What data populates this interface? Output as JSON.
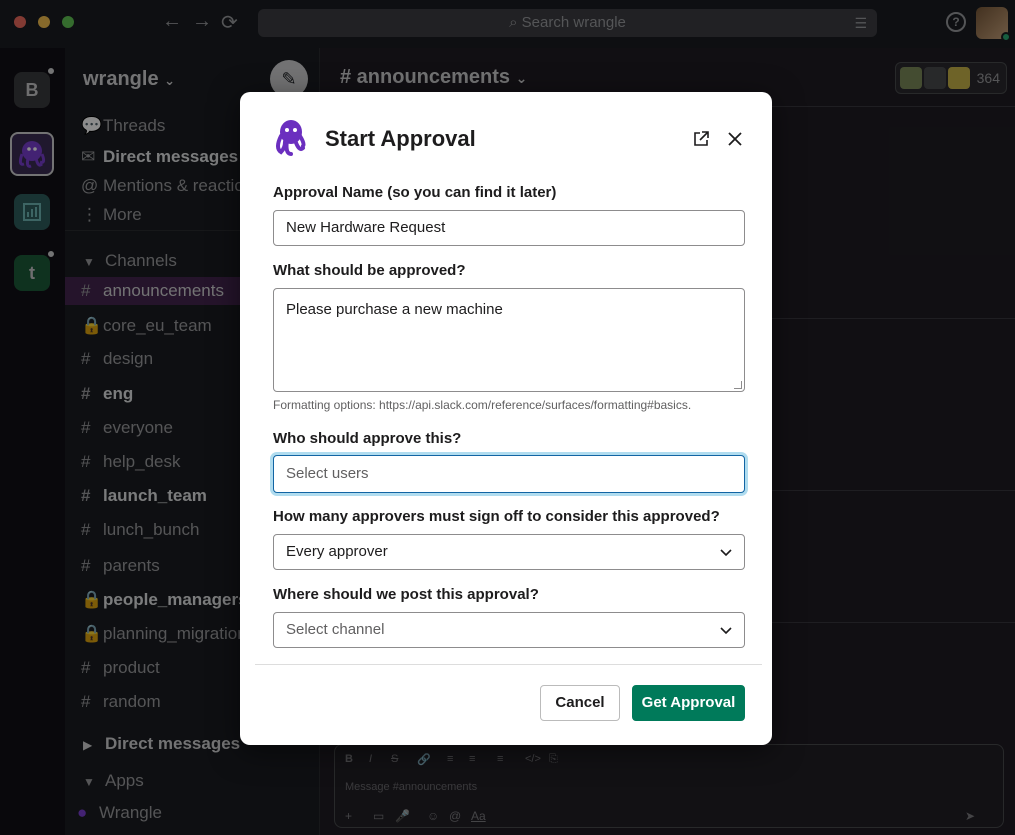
{
  "titlebar": {
    "search_placeholder": "Search wrangle"
  },
  "rail": {
    "workspaces": [
      {
        "letter": "B"
      },
      {
        "letter": ""
      },
      {
        "letter": ""
      },
      {
        "letter": "t"
      }
    ]
  },
  "sidebar": {
    "workspace_name": "wrangle",
    "nav": [
      {
        "label": "Threads",
        "icon": "threads-icon"
      },
      {
        "label": "Direct messages",
        "icon": "dm-icon"
      },
      {
        "label": "Mentions & reactions",
        "icon": "at-icon"
      },
      {
        "label": "More",
        "icon": "more-icon"
      }
    ],
    "channels_header": "Channels",
    "channels": [
      {
        "name": "announcements",
        "prefix": "#"
      },
      {
        "name": "core_eu_team",
        "prefix": "lock"
      },
      {
        "name": "design",
        "prefix": "#"
      },
      {
        "name": "eng",
        "prefix": "#"
      },
      {
        "name": "everyone",
        "prefix": "#"
      },
      {
        "name": "help_desk",
        "prefix": "#"
      },
      {
        "name": "launch_team",
        "prefix": "#"
      },
      {
        "name": "lunch_bunch",
        "prefix": "#"
      },
      {
        "name": "parents",
        "prefix": "#"
      },
      {
        "name": "people_managers",
        "prefix": "lock"
      },
      {
        "name": "planning_migration",
        "prefix": "lock"
      },
      {
        "name": "product",
        "prefix": "#"
      },
      {
        "name": "random",
        "prefix": "#"
      }
    ],
    "dm_header": "Direct messages",
    "apps_header": "Apps",
    "apps": [
      {
        "name": "Wrangle"
      }
    ]
  },
  "channel": {
    "title": "# announcements",
    "member_count": "364",
    "composer_placeholder": "Message #announcements",
    "composer_format_buttons": [
      "B",
      "I",
      "S",
      "🔗",
      "≡",
      "≡",
      "≡",
      "</>",
      "⎘"
    ],
    "composer_bottom_buttons": [
      "+",
      "▭",
      "🎤",
      "☺",
      "@",
      "Aa"
    ]
  },
  "modal": {
    "title": "Start Approval",
    "fields": {
      "name_label": "Approval Name (so you can find it later)",
      "name_value": "New Hardware Request",
      "what_label": "What should be approved?",
      "what_value": "Please purchase a new machine",
      "format_hint": "Formatting options: https://api.slack.com/reference/surfaces/formatting#basics.",
      "who_label": "Who should approve this?",
      "who_placeholder": "Select users",
      "count_label": "How many approvers must sign off to consider this approved?",
      "count_value": "Every approver",
      "where_label": "Where should we post this approval?",
      "where_placeholder": "Select channel"
    },
    "cancel_label": "Cancel",
    "submit_label": "Get Approval"
  },
  "colors": {
    "primary_button": "#007a5a",
    "focus_ring": "#1264a3",
    "active_channel": "#44254f",
    "app_purple": "#6b2fbf"
  }
}
